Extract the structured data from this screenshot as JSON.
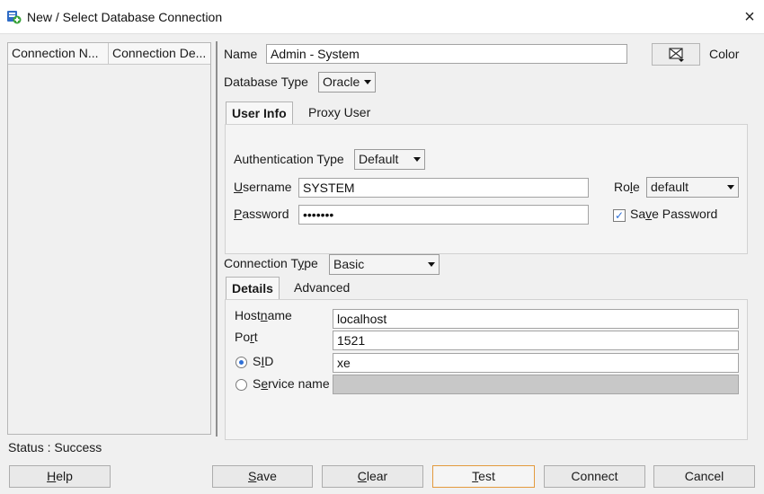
{
  "window": {
    "title": "New / Select Database Connection",
    "close_glyph": "×"
  },
  "connections": {
    "columns": [
      "Connection N...",
      "Connection De..."
    ]
  },
  "form": {
    "name_label": "Name",
    "name_value": "Admin - System",
    "color_label": "Color",
    "db_type_label": "Database Type",
    "db_type_value": "Oracle",
    "tabs": [
      "User Info",
      "Proxy User"
    ],
    "auth_type_label": "Authentication Type",
    "auth_type_value": "Default",
    "username_label_u": "U",
    "username_label_rest": "sername",
    "username_value": "SYSTEM",
    "password_label_u": "P",
    "password_label_rest": "assword",
    "password_value": "•••••••",
    "role_label_pre": "Ro",
    "role_label_u": "l",
    "role_label_post": "e",
    "role_value": "default",
    "save_password_pre": "Sa",
    "save_password_u": "v",
    "save_password_post": "e Password",
    "save_password_checked": true,
    "conn_type_label_pre": "Connection T",
    "conn_type_label_u": "y",
    "conn_type_label_post": "pe",
    "conn_type_value": "Basic",
    "detail_tabs": [
      "Details",
      "Advanced"
    ],
    "hostname_label_pre": "Host",
    "hostname_label_u": "n",
    "hostname_label_post": "ame",
    "hostname_value": "localhost",
    "port_label_pre": "Po",
    "port_label_u": "r",
    "port_label_post": "t",
    "port_value": "1521",
    "sid_label_pre": "S",
    "sid_label_u": "I",
    "sid_label_post": "D",
    "sid_value": "xe",
    "sid_selected": true,
    "service_label_pre": "S",
    "service_label_u": "e",
    "service_label_post": "rvice name",
    "service_value": ""
  },
  "status": {
    "text": "Status : Success"
  },
  "buttons": [
    {
      "u": "H",
      "rest": "elp"
    },
    {
      "u": "S",
      "rest": "ave"
    },
    {
      "u": "C",
      "rest": "lear"
    },
    {
      "u": "T",
      "rest": "est"
    },
    {
      "u": "C",
      "rest": "onnect",
      "first_plain": true
    },
    {
      "label": "Cancel"
    }
  ],
  "icons": {
    "app": "database-add-icon",
    "color": "color-picker-icon",
    "dropdown": "chevron-down-icon"
  },
  "colors": {
    "focus_border": "#e39a3d",
    "radio_checked": "#2e6fd6",
    "disabled_field": "#c8c8c8",
    "app_icon_green": "#3aa33a",
    "app_icon_blue": "#2f6cc6"
  }
}
